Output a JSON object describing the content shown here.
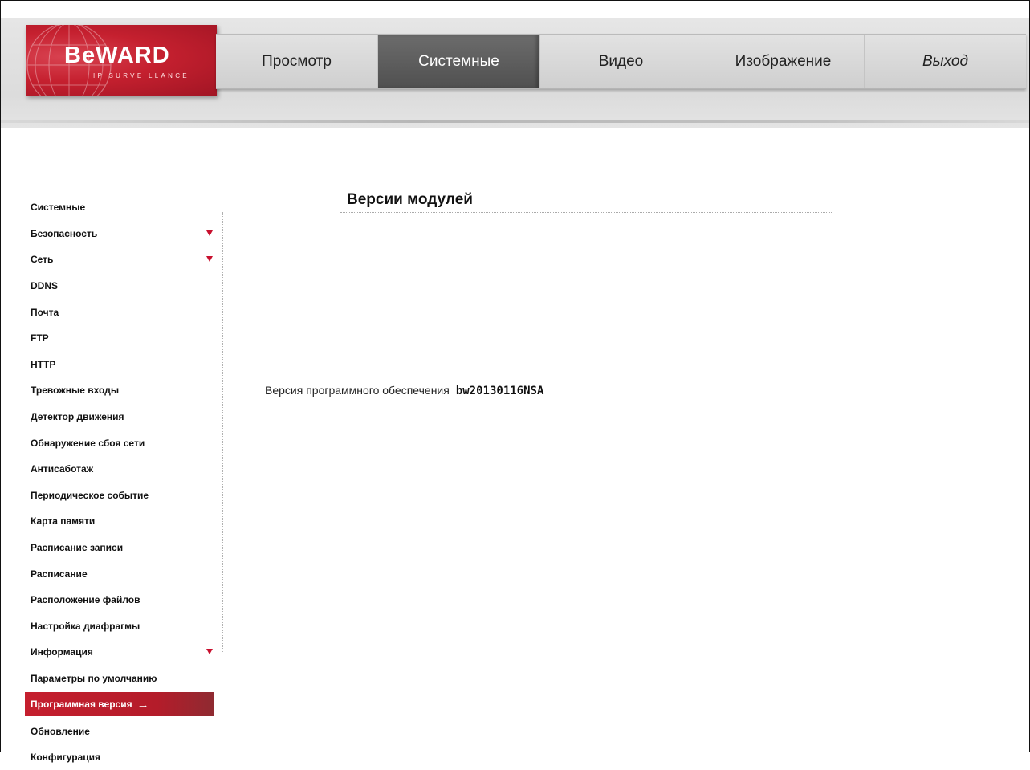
{
  "logo": {
    "brand": "BeWARD",
    "tagline": "IP SURVEILLANCE"
  },
  "topnav": [
    {
      "label": "Просмотр"
    },
    {
      "label": "Системные",
      "active": true
    },
    {
      "label": "Видео"
    },
    {
      "label": "Изображение"
    },
    {
      "label": "Выход"
    }
  ],
  "sidebar": {
    "items": [
      {
        "label": "Системные"
      },
      {
        "label": "Безопасность",
        "expandable": true
      },
      {
        "label": "Сеть",
        "expandable": true
      },
      {
        "label": "DDNS"
      },
      {
        "label": "Почта"
      },
      {
        "label": "FTP"
      },
      {
        "label": "HTTP"
      },
      {
        "label": "Тревожные входы"
      },
      {
        "label": "Детектор движения"
      },
      {
        "label": "Обнаружение сбоя сети"
      },
      {
        "label": "Антисаботаж"
      },
      {
        "label": "Периодическое событие"
      },
      {
        "label": "Карта памяти"
      },
      {
        "label": "Расписание записи"
      },
      {
        "label": "Расписание"
      },
      {
        "label": "Расположение файлов"
      },
      {
        "label": "Настройка диафрагмы"
      },
      {
        "label": "Информация",
        "expandable": true
      },
      {
        "label": "Параметры по умолчанию"
      },
      {
        "label": "Программная версия",
        "active": true
      },
      {
        "label": "Обновление"
      },
      {
        "label": "Конфигурация"
      }
    ]
  },
  "main": {
    "title": "Версии модулей",
    "firmware_label": "Версия программного обеспечения",
    "firmware_value": "bw20130116NSA"
  },
  "colors": {
    "accent": "#c51f2e",
    "active_tab": "#5a5a5a"
  }
}
